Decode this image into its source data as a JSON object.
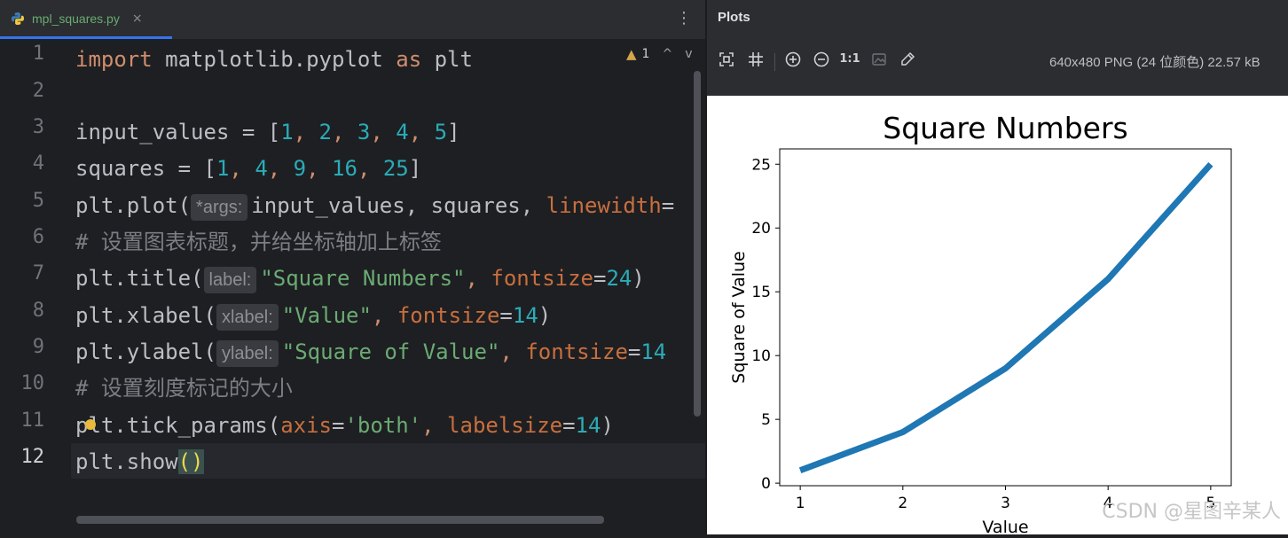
{
  "tab": {
    "filename": "mpl_squares.py",
    "close_glyph": "×",
    "menu_glyph": "⋮"
  },
  "inspection": {
    "warning_count": "1",
    "up_glyph": "^",
    "down_glyph": "v"
  },
  "line_numbers": [
    "1",
    "2",
    "3",
    "4",
    "5",
    "6",
    "7",
    "8",
    "9",
    "10",
    "11",
    "12"
  ],
  "code": {
    "l1": {
      "kw_import": "import",
      "module": " matplotlib.pyplot ",
      "kw_as": "as",
      "alias": " plt"
    },
    "l3": {
      "t1": "input_values = [",
      "n1": "1",
      "c1": ", ",
      "n2": "2",
      "c2": ", ",
      "n3": "3",
      "c3": ", ",
      "n4": "4",
      "c4": ", ",
      "n5": "5",
      "t2": "]"
    },
    "l4": {
      "t1": "squares = [",
      "n1": "1",
      "c1": ", ",
      "n2": "4",
      "c2": ", ",
      "n3": "9",
      "c3": ", ",
      "n4": "16",
      "c4": ", ",
      "n5": "25",
      "t2": "]"
    },
    "l5": {
      "t1": "plt.plot(",
      "hint": "*args:",
      "t2": "input_values, squares, ",
      "p1": "linewidth",
      "t3": "="
    },
    "l6": {
      "comment": "# 设置图表标题，并给坐标轴加上标签"
    },
    "l7": {
      "t1": "plt.title(",
      "hint": "label:",
      "s1": "\"Square Numbers\"",
      "t2": ", ",
      "p1": "fontsize",
      "t3": "=",
      "n1": "24",
      "t4": ")"
    },
    "l8": {
      "t1": "plt.xlabel(",
      "hint": "xlabel:",
      "s1": "\"Value\"",
      "t2": ", ",
      "p1": "fontsize",
      "t3": "=",
      "n1": "14",
      "t4": ")"
    },
    "l9": {
      "t1": "plt.ylabel(",
      "hint": "ylabel:",
      "s1": "\"Square of Value\"",
      "t2": ", ",
      "p1": "fontsize",
      "t3": "=",
      "n1": "14"
    },
    "l10": {
      "comment": "# 设置刻度标记的大小"
    },
    "l11": {
      "t1": "plt.tick_params(",
      "p1": "axis",
      "t2": "=",
      "s1": "'both'",
      "t3": ", ",
      "p2": "labelsize",
      "t4": "=",
      "n1": "14",
      "t5": ")"
    },
    "l12": {
      "t1": "plt.show",
      "t2": "()"
    }
  },
  "plots_panel": {
    "title": "Plots",
    "image_info": "640x480 PNG (24 位颜色) 22.57 kB",
    "zoom_label": "1:1"
  },
  "watermark": "CSDN @星图辛某人",
  "chart_data": {
    "type": "line",
    "title": "Square Numbers",
    "xlabel": "Value",
    "ylabel": "Square of Value",
    "x": [
      1,
      2,
      3,
      4,
      5
    ],
    "series": [
      {
        "values": [
          1,
          4,
          9,
          16,
          25
        ],
        "color": "#1f77b4"
      }
    ],
    "xlim": [
      0.8,
      5.2
    ],
    "ylim": [
      -0.2,
      26.2
    ],
    "xticks": [
      1,
      2,
      3,
      4,
      5
    ],
    "yticks": [
      0,
      5,
      10,
      15,
      20,
      25
    ],
    "grid": false
  }
}
